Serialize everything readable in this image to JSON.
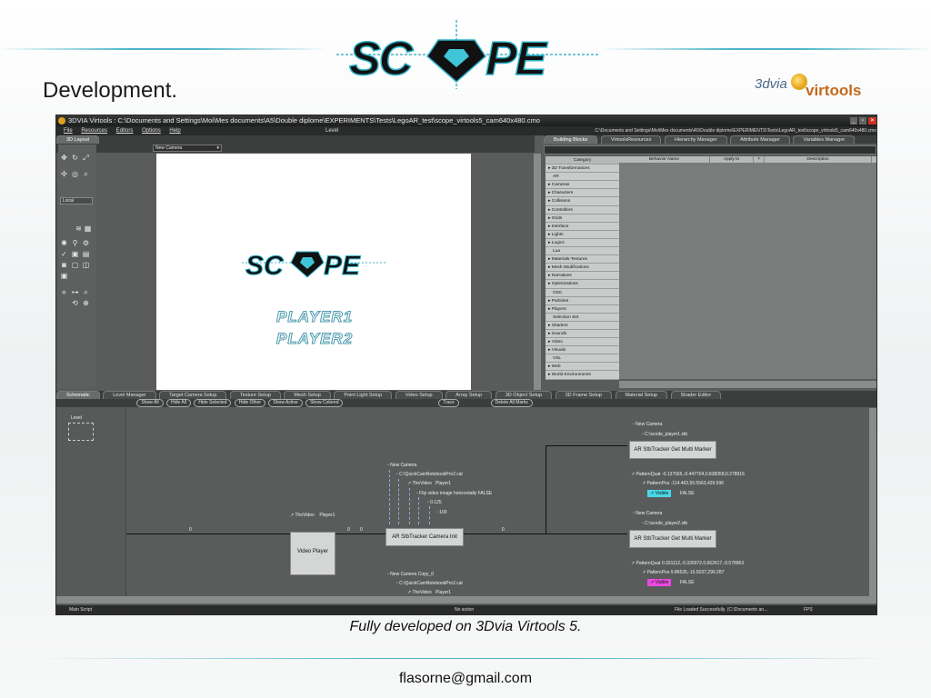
{
  "slide": {
    "title": "Development.",
    "caption": "Fully developed on 3Dvia Virtools 5.",
    "footer": "flasorne@gmail.com",
    "brand_logo_text": "SCOPE",
    "partner_logo_text_1": "3dvia",
    "partner_logo_text_2": "virtools",
    "accent_color": "#4ab4c8"
  },
  "app": {
    "window_title": "3DVIA Virtools : C:\\Documents and Settings\\Moi\\Mes documents\\A5\\Double diplome\\EXPERIMENTS\\Tests\\LegoAR_test\\scope_virtools5_cam640x480.cmo",
    "level_label": "Level",
    "path_right": "C:\\Documents and Settings\\Moi\\Mes documents\\A5\\Double diplome\\EXPERIMENTS\\Tests\\LegoAR_test\\scope_virtools5_cam640x480.cmo",
    "menu": [
      "File",
      "Resources",
      "Editors",
      "Options",
      "Help"
    ],
    "layout_tab": "3D Layout",
    "camera_select": "New Camera",
    "coord_mode": "Local",
    "right_tabs": [
      "Building Blocks",
      "VirtoolsResources",
      "Hierarchy Manager",
      "Attribute Manager",
      "Variables Manager"
    ],
    "categories_header": "Category",
    "categories": [
      "3D Transformations",
      "AR",
      "Cameras",
      "Characters",
      "Collisions",
      "Controllers",
      "Grids",
      "Interface",
      "Lights",
      "Logics",
      "Lua",
      "Materials-Textures",
      "Mesh Modifications",
      "Narratives",
      "Optimizations",
      "OSC",
      "Particles",
      "Players",
      "Selection Set",
      "Shaders",
      "Sounds",
      "Video",
      "Visuals",
      "VSL",
      "Web",
      "World Environments"
    ],
    "behavior_columns": [
      "Behavior Name",
      "Apply to",
      "?",
      "Description"
    ],
    "viewport_players": [
      "PLAYER1",
      "PLAYER2"
    ],
    "bottom_tabs": [
      "Schematic",
      "Level Manager",
      "Target Camera Setup",
      "Texture Setup",
      "Mesh Setup",
      "Point Light Setup",
      "Video Setup",
      "Array Setup",
      "3D Object Setup",
      "3D Frame Setup",
      "Material Setup",
      "Shader Editor"
    ],
    "schematic_buttons": [
      "Show All",
      "Hide All",
      "Hide Selected",
      "Hide Other",
      "Show Active",
      "Show Colored",
      "Trace",
      "Delete All Marks"
    ],
    "level_item": "Level",
    "nodes": {
      "video_player": "Video Player",
      "camera_init": "AR StbTracker Camera Init",
      "marker1": "AR StbTracker Get Multi Marker",
      "marker2": "AR StbTracker Get Multi Marker"
    },
    "params": {
      "the_video": "TheVideo",
      "player1": "Player1",
      "new_camera": "New Camera",
      "cam_cal": "C:\\QuickCamNotebookPro2.cal",
      "flip": "Flip video image horizontally  FALSE",
      "v0125": "0.125",
      "v100": "100",
      "scode1": "C:\\scode_player1.stb",
      "scode2": "C:\\scode_player2.stb",
      "pq1": "PatternQuat  -0.137565,-0.447704,0.838358,0.278916",
      "pp1": "PatternPos   -114.463,55.5563,429.596",
      "pq2": "PatternQuat  0.331112,-0.335972,0.662617,-0.578963",
      "pp2": "PatternPos   9.86635,-15.5037,299.287",
      "visible": "Visible",
      "false_val": "FALSE",
      "new_camera_copy": "New Camera Copy_0",
      "zero_a": "0",
      "zero_b": "0",
      "zero_c": "0",
      "zero_d": "0"
    },
    "status_left": "Main Script",
    "status_mid": "No action",
    "status_right": "File Loaded Successfully. (C:\\Documents an...",
    "fps_label": "FPS"
  }
}
